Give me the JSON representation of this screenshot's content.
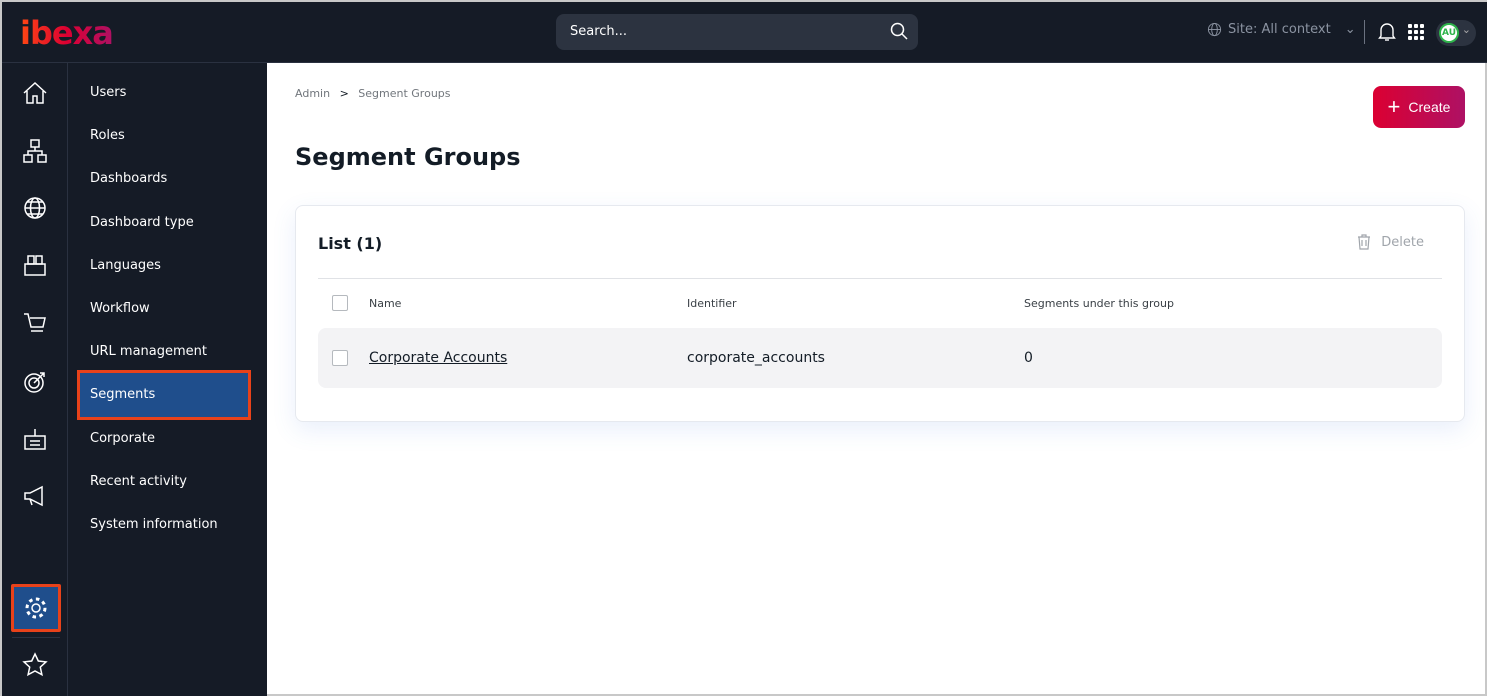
{
  "header": {
    "logo": "ibexa",
    "search_placeholder": "Search...",
    "site_context": "Site: All context",
    "avatar": "AU"
  },
  "rail": {
    "icons": [
      "home-icon",
      "content-tree-icon",
      "globe-icon",
      "product-catalog-icon",
      "cart-icon",
      "target-icon",
      "customer-portal-icon",
      "megaphone-icon",
      "gear-icon",
      "star-icon"
    ]
  },
  "submenu": {
    "items": [
      "Users",
      "Roles",
      "Dashboards",
      "Dashboard type",
      "Languages",
      "Workflow",
      "URL management",
      "Segments",
      "Corporate",
      "Recent activity",
      "System information"
    ],
    "selected": "Segments"
  },
  "breadcrumb": {
    "items": [
      "Admin",
      "Segment Groups"
    ],
    "separator": ">"
  },
  "page": {
    "title": "Segment Groups",
    "create_label": "Create"
  },
  "list": {
    "title": "List (1)",
    "delete_label": "Delete",
    "columns": [
      "Name",
      "Identifier",
      "Segments under this group"
    ],
    "rows": [
      {
        "name": "Corporate Accounts",
        "identifier": "corporate_accounts",
        "segments": "0"
      }
    ]
  },
  "colors": {
    "accent": "#db0032",
    "highlight": "#1f4e8c",
    "annotation": "#e8421a",
    "bg_dark": "#151b26"
  }
}
